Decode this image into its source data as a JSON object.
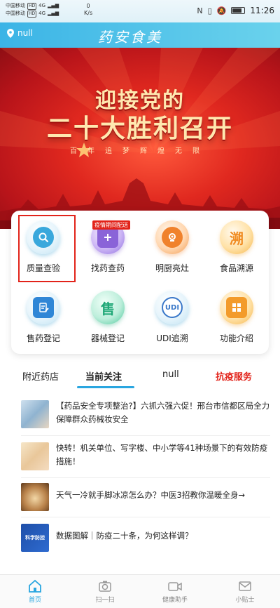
{
  "status_bar": {
    "carrier1": "中国移动",
    "carrier2": "中国移动",
    "hd": "HD",
    "signal1": "4G",
    "signal2": "4G",
    "speed_value": "0",
    "speed_unit": "K/s",
    "time": "11:26"
  },
  "header": {
    "location": "null",
    "logo": "药安食美"
  },
  "banner": {
    "line1": "迎接党的",
    "line2": "二十大胜利召开",
    "subtitle": "百年追梦辉煌无限"
  },
  "features": {
    "tag": "疫情期间配送",
    "items": [
      {
        "label": "质量查验",
        "icon": "search-icon",
        "color": "#3aa8dc"
      },
      {
        "label": "找药查药",
        "icon": "medicine-box-icon",
        "color": "#8a63d8"
      },
      {
        "label": "明厨亮灶",
        "icon": "camera-icon",
        "color": "#f0822c"
      },
      {
        "label": "食品溯源",
        "icon": "trace-icon",
        "glyph": "溯",
        "color": "#f3a52b"
      },
      {
        "label": "售药登记",
        "icon": "register-icon",
        "color": "#2f86d6"
      },
      {
        "label": "器械登记",
        "icon": "device-icon",
        "glyph": "售",
        "color": "#2bb583"
      },
      {
        "label": "UDI追溯",
        "icon": "udi-icon",
        "glyph": "UDI",
        "color": "#3a78c9"
      },
      {
        "label": "功能介绍",
        "icon": "apps-icon",
        "color": "#f39b2a"
      }
    ]
  },
  "tabs": [
    {
      "label": "附近药店"
    },
    {
      "label": "当前关注"
    },
    {
      "label": "null"
    },
    {
      "label": "抗疫服务"
    }
  ],
  "news": [
    {
      "text": "【药品安全专项整治?】六抓六强六促！邢台市信都区局全力保障群众药械妆安全"
    },
    {
      "text": "快转！机关单位、写字楼、中小学等41种场景下的有效防疫措施！"
    },
    {
      "text": "天气一冷就手脚冰凉怎么办？中医3招教你温暖全身→"
    },
    {
      "text": "数据图解｜防疫二十条，为何这样调？",
      "thumb_text": "科学防控"
    }
  ],
  "bottom_nav": [
    {
      "label": "首页"
    },
    {
      "label": "扫一扫"
    },
    {
      "label": "健康助手"
    },
    {
      "label": "小贴士"
    }
  ],
  "colors": {
    "accent": "#2aa6e0",
    "highlight": "#e2231a",
    "banner_red": "#d8231b"
  }
}
